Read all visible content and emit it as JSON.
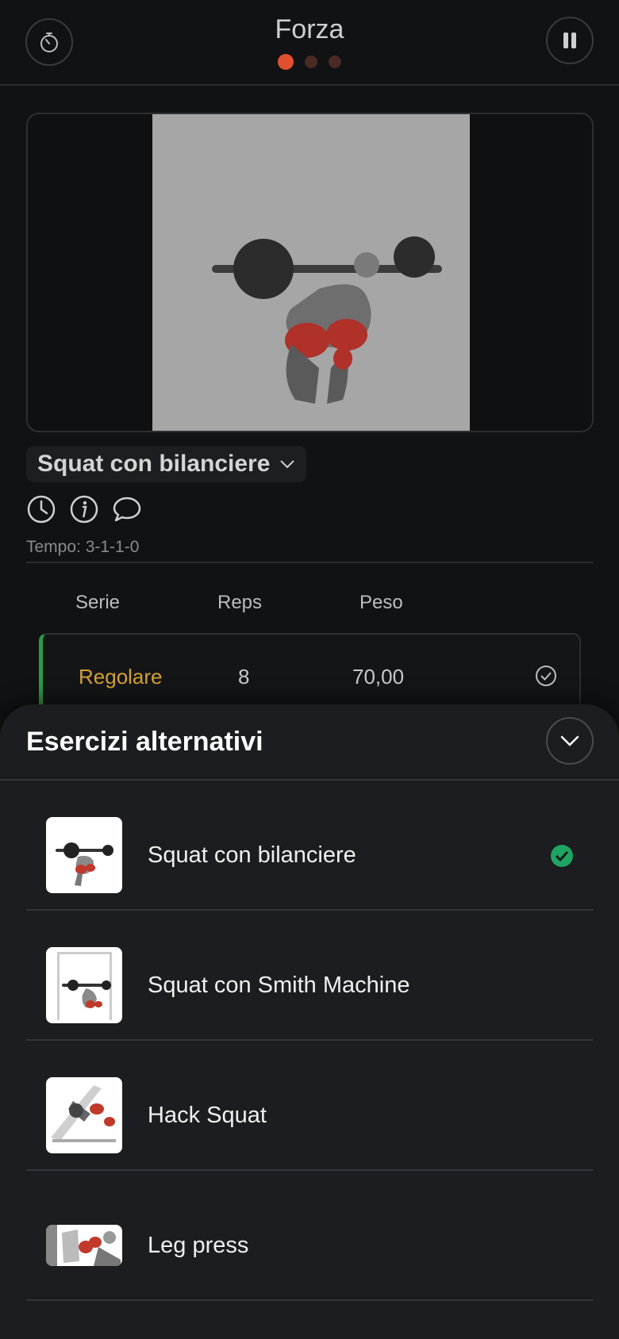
{
  "header": {
    "title": "Forza",
    "timer_icon": "stopwatch-icon",
    "pause_icon": "pause-icon",
    "page_dots": {
      "count": 3,
      "active_index": 0
    }
  },
  "exercise": {
    "name": "Squat con bilanciere",
    "tempo": "Tempo: 3-1-1-0",
    "icons": [
      "clock-icon",
      "info-icon",
      "comment-icon"
    ]
  },
  "sets_table": {
    "headers": {
      "serie": "Serie",
      "reps": "Reps",
      "peso": "Peso"
    },
    "rows": [
      {
        "tipo": "Regolare",
        "reps": "8",
        "peso": "70,00"
      }
    ]
  },
  "alternatives_sheet": {
    "title": "Esercizi alternativi",
    "items": [
      {
        "label": "Squat con bilanciere",
        "selected": true
      },
      {
        "label": "Squat con Smith Machine",
        "selected": false
      },
      {
        "label": "Hack Squat",
        "selected": false
      },
      {
        "label": "Leg press",
        "selected": false
      }
    ]
  },
  "colors": {
    "accent": "#e0502e",
    "set_type": "#d4a033",
    "selected_check": "#1fa463",
    "row_indicator": "#2f9a45"
  }
}
